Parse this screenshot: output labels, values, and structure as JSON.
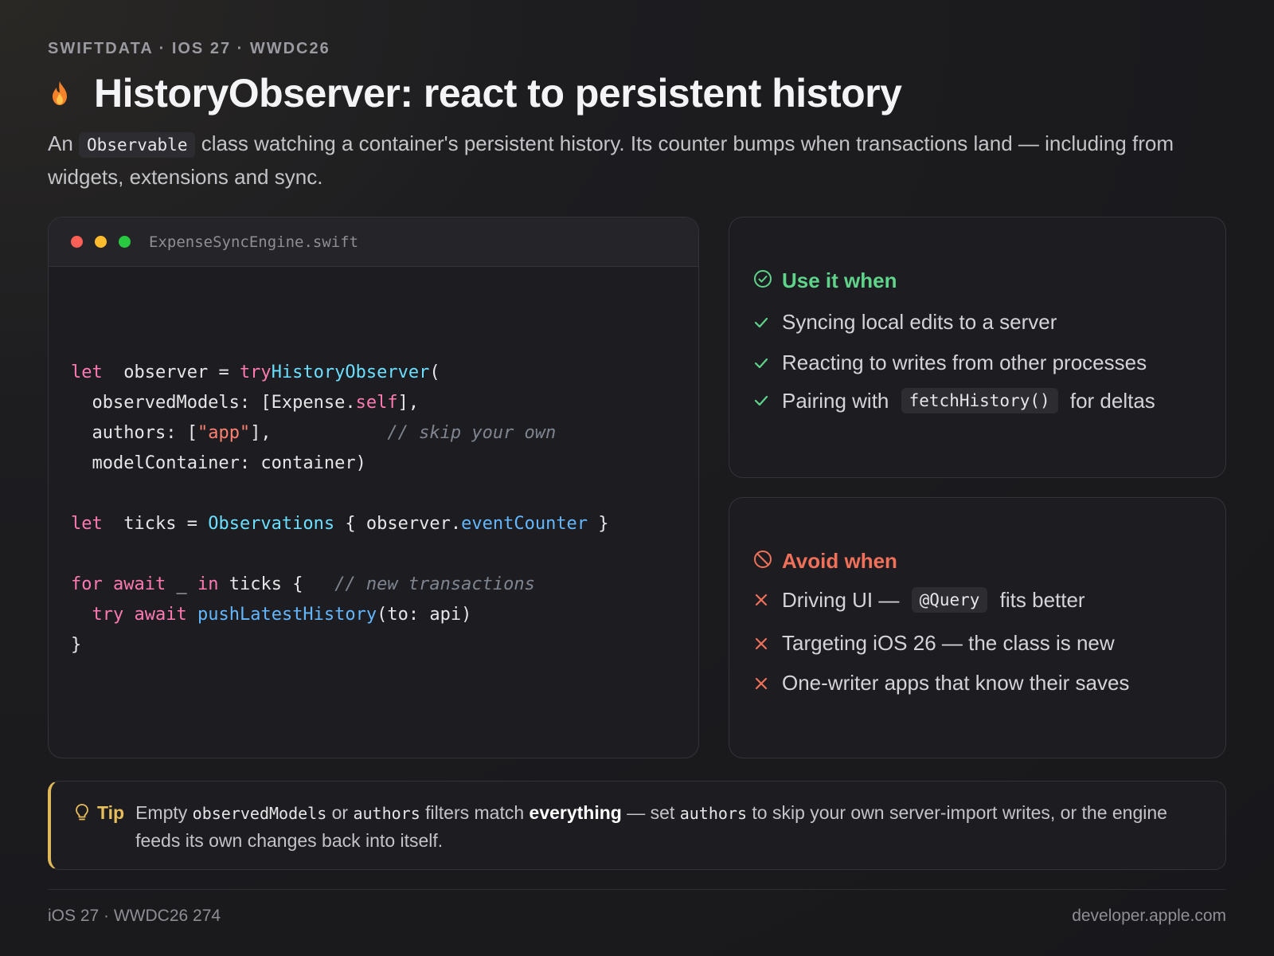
{
  "header": {
    "eyebrow": "SWIFTDATA · IOS 27 · WWDC26",
    "title": "HistoryObserver: react to persistent history",
    "subtitle_before": "An ",
    "subtitle_code": "Observable",
    "subtitle_after": " class watching a container's persistent history. Its counter bumps when transactions land — including from widgets, extensions and sync."
  },
  "code_window": {
    "filename": "ExpenseSyncEngine.swift",
    "traffic_lights": [
      "#ff5f57",
      "#febc2e",
      "#28c840"
    ],
    "lines": [
      [
        [
          "kw",
          "let"
        ],
        [
          "",
          "  observer = "
        ],
        [
          "kw",
          "try"
        ],
        [
          "",
          ""
        ],
        [
          "ty",
          "HistoryObserver"
        ],
        [
          "",
          "("
        ]
      ],
      [
        [
          "",
          "  observedModels: [Expense."
        ],
        [
          "sf",
          "self"
        ],
        [
          "",
          "],"
        ]
      ],
      [
        [
          "",
          "  authors: ["
        ],
        [
          "st",
          "\"app\""
        ],
        [
          "",
          "],           "
        ],
        [
          "cm",
          "// skip your own"
        ]
      ],
      [
        [
          "",
          "  modelContainer: container)"
        ]
      ],
      [],
      [
        [
          "kw",
          "let"
        ],
        [
          "",
          "  ticks = "
        ],
        [
          "ty",
          "Observations"
        ],
        [
          "",
          " { observer."
        ],
        [
          "pr",
          "eventCounter"
        ],
        [
          "",
          " }"
        ]
      ],
      [],
      [
        [
          "kw",
          "for"
        ],
        [
          "",
          " "
        ],
        [
          "kw",
          "await"
        ],
        [
          "",
          " _ "
        ],
        [
          "kw",
          "in"
        ],
        [
          "",
          " ticks {   "
        ],
        [
          "cm",
          "// new transactions"
        ]
      ],
      [
        [
          "",
          "  "
        ],
        [
          "kw",
          "try"
        ],
        [
          "",
          " "
        ],
        [
          "kw",
          "await"
        ],
        [
          "",
          " "
        ],
        [
          "fn",
          "pushLatestHistory"
        ],
        [
          "",
          "(to: api)"
        ]
      ],
      [
        [
          "",
          "}"
        ]
      ]
    ]
  },
  "use_panel": {
    "title": "Use it when",
    "color": "#5fd38a",
    "items": [
      {
        "text": "Syncing local edits to a server"
      },
      {
        "text": "Reacting to writes from other processes"
      },
      {
        "before": "Pairing with ",
        "code": "fetchHistory()",
        "after": " for deltas"
      }
    ]
  },
  "avoid_panel": {
    "title": "Avoid when",
    "color": "#f0705a",
    "items": [
      {
        "before": "Driving UI — ",
        "code": "@Query",
        "after": " fits better"
      },
      {
        "text": "Targeting iOS 26 — the class is new"
      },
      {
        "text": "One-writer apps that know their saves"
      }
    ]
  },
  "tip": {
    "label": "Tip",
    "t1": "Empty ",
    "c1": "observedModels",
    "t2": " or ",
    "c2": "authors",
    "t3": " filters match ",
    "bold": "everything",
    "t4": " — set ",
    "c3": "authors",
    "t5": " to skip your own server-import writes, or the engine feeds its own changes back into itself."
  },
  "footer": {
    "left": "iOS 27 · WWDC26 274",
    "right": "developer.apple.com"
  }
}
